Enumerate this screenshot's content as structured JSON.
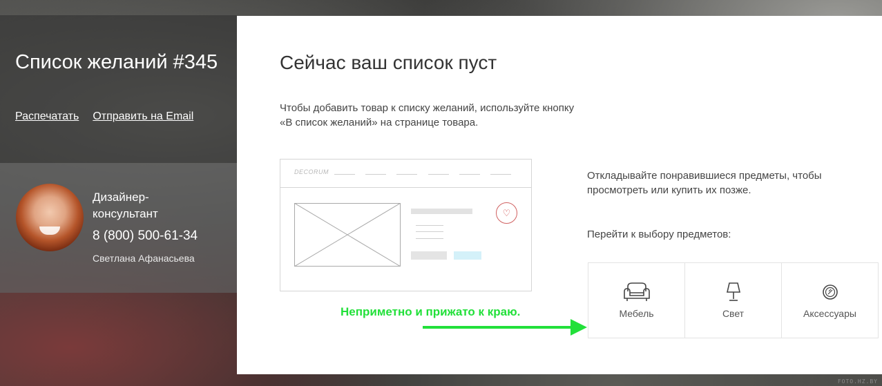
{
  "sidebar": {
    "title": "Список желаний #345",
    "links": {
      "print": "Распечатать",
      "email": "Отправить на Email"
    },
    "contact": {
      "role": "Дизайнер-консультант",
      "phone": "8 (800) 500-61-34",
      "name": "Светлана Афанасьева"
    }
  },
  "main": {
    "title": "Сейчас ваш список пуст",
    "description_line1": "Чтобы добавить товар к списку желаний, используйте кнопку",
    "description_line2": "«В список желаний» на странице товара.",
    "wireframe": {
      "logo": "DECORUM"
    },
    "hint_text": "Откладывайте понравившиеся предметы, чтобы просмотреть или купить их позже.",
    "goto_label": "Перейти к выбору предметов:",
    "categories": [
      {
        "label": "Мебель",
        "icon": "armchair-icon"
      },
      {
        "label": "Свет",
        "icon": "lamp-icon"
      },
      {
        "label": "Аксессуары",
        "icon": "mirror-icon"
      }
    ]
  },
  "annotation": {
    "text": "Неприметно и прижато к краю.",
    "color": "#22e03a"
  },
  "watermark": "FOTO.HZ.BY",
  "colors": {
    "panel_bg": "#ffffff",
    "heart_accent": "#d06060",
    "wire_button": "#d4f1f9"
  }
}
